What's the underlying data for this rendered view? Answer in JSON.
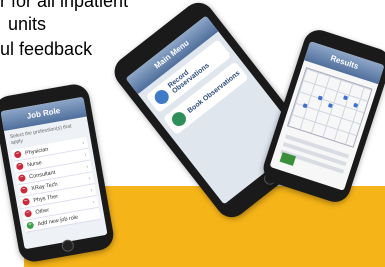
{
  "slide": {
    "text_lines": [
      "r for all inpatient",
      "units",
      "ul feedback"
    ]
  },
  "colors": {
    "band": "#f5b417",
    "nav": "#4f6f9c",
    "remove_dot": "#d2263b",
    "add_dot": "#3aa24a"
  },
  "phone_job_role": {
    "title": "Job Role",
    "subtitle": "Select the profession(s) that apply",
    "items": [
      "Physician",
      "Nurse",
      "Consultant",
      "XRay Tech",
      "Phys Ther",
      "Other"
    ],
    "add_label": "Add new job role"
  },
  "phone_main_menu": {
    "title": "Main Menu",
    "items": [
      "Record Observations",
      "Book Observations"
    ]
  },
  "phone_chart": {
    "title": "Results"
  }
}
